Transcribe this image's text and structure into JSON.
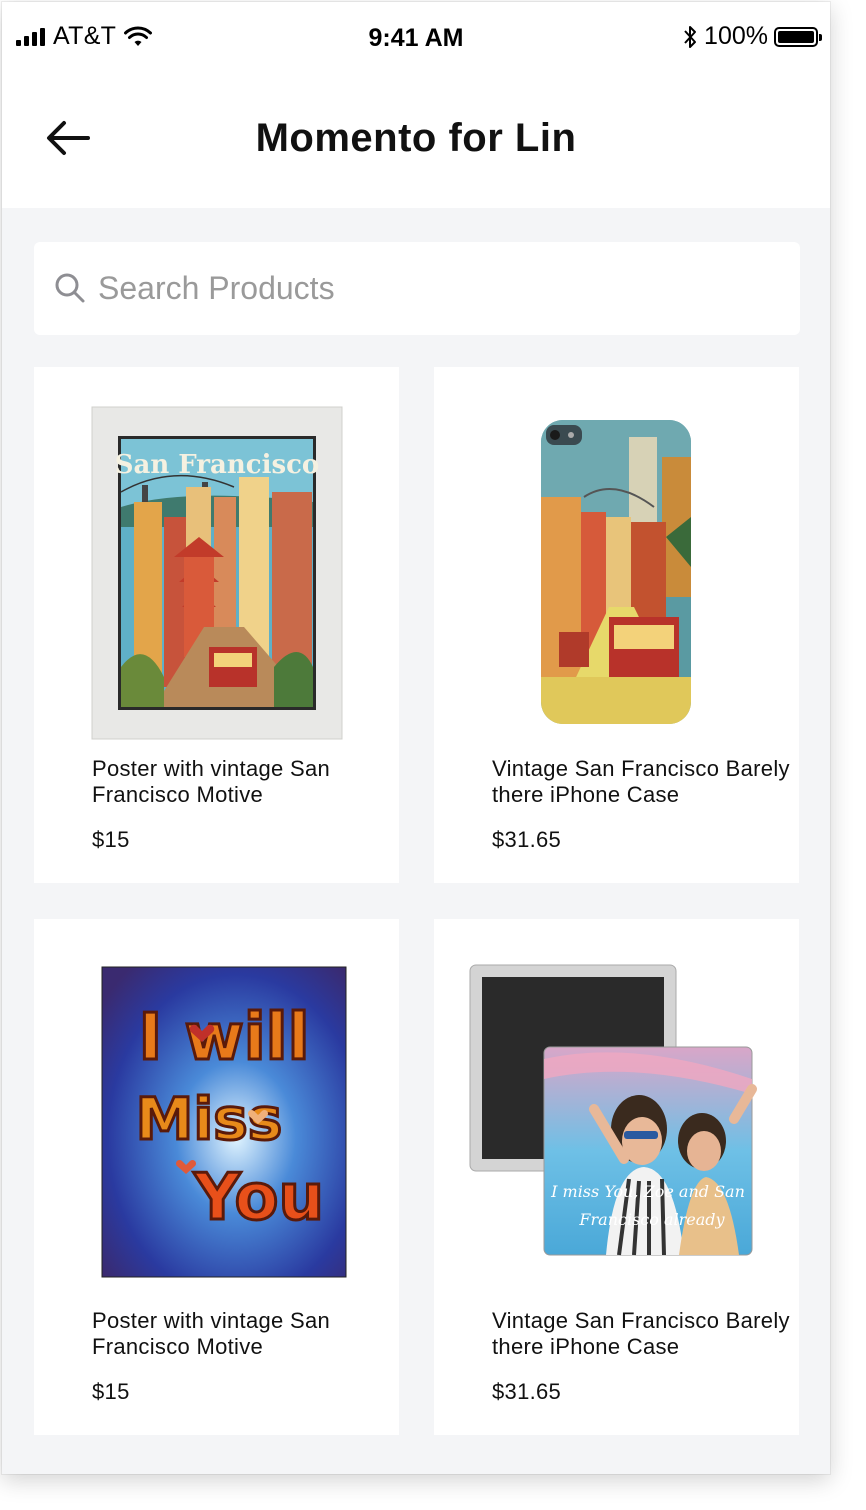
{
  "status_bar": {
    "carrier": "AT&T",
    "time": "9:41 AM",
    "battery": "100%"
  },
  "header": {
    "title": "Momento for Lin",
    "back_icon": "arrow-left-icon"
  },
  "search": {
    "placeholder": "Search Products",
    "value": "",
    "icon": "search-icon"
  },
  "products": [
    {
      "name": "Poster with vintage San Francisco Motive",
      "price": "$15",
      "image_text": "San Francisco"
    },
    {
      "name": "Vintage San Francisco Barely there iPhone Case",
      "price": "$31.65"
    },
    {
      "name": "Poster with vintage San Francisco Motive",
      "price": "$15",
      "image_text_1": "I will",
      "image_text_2": "Miss",
      "image_text_3": "You"
    },
    {
      "name": "Vintage San Francisco Barely there iPhone Case",
      "price": "$31.65",
      "image_text_1": "I miss You, Zoe and San",
      "image_text_2": "Francisco already"
    }
  ],
  "colors": {
    "background": "#f4f5f7",
    "card": "#ffffff",
    "text": "#111111",
    "placeholder": "#9a9a9a"
  }
}
